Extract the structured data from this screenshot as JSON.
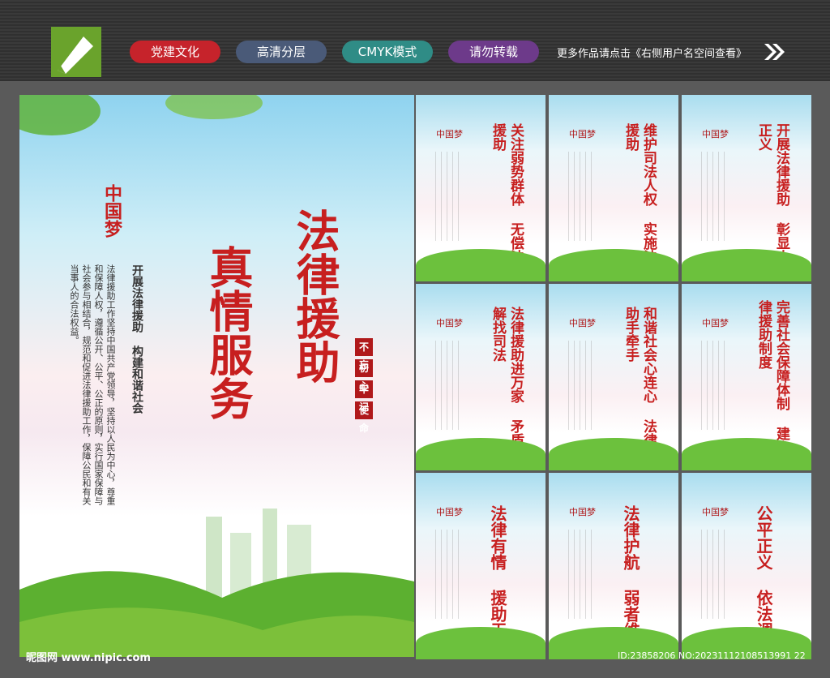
{
  "header": {
    "tags": [
      "党建文化",
      "高清分层",
      "CMYK模式",
      "请勿转载"
    ],
    "tag_colors": [
      "#c6232b",
      "#4a5a78",
      "#2f8c86",
      "#6d3a8a"
    ],
    "more_text": "更多作品请点击《右侧用户名空间查看》"
  },
  "main": {
    "title_line1": "法律援助",
    "title_line2": "真情服务",
    "dream_mark": "中国梦",
    "subtitle": "开展法律援助 构建和谐社会",
    "body": "法律援助工作坚持中国共产党领导，坚持以人民为中心，尊重和保障人权，遵循公开、公平、公正的原则，实行国家保障与社会参与相结合，规范和促进法律援助工作，保障公民和有关当事人的合法权益。",
    "seal": [
      "不忘",
      "初心",
      "牢记",
      "使命"
    ]
  },
  "cards": [
    {
      "title": "关注弱势群体\n无偿法律援助"
    },
    {
      "title": "维护司法人权\n实施法律援助"
    },
    {
      "title": "开展法律援助\n彰显人间正义"
    },
    {
      "title": "法律援助进万家\n矛盾化解找司法"
    },
    {
      "title": "和谐社会心连心\n法律援助手牵手"
    },
    {
      "title": "完善社会保障体制\n建立法律援助制度"
    },
    {
      "title": "法律有情\n援助无忧"
    },
    {
      "title": "法律护航\n弱者维权"
    },
    {
      "title": "公平正义\n依法调解"
    }
  ],
  "footer": {
    "site": "昵图网 www.nipic.com",
    "id": "ID:23858206 NO:20231112108513991 22"
  }
}
